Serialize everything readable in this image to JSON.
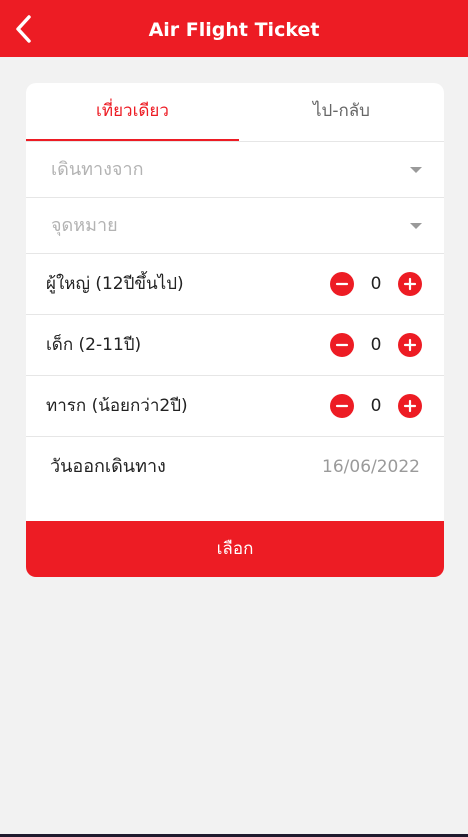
{
  "header": {
    "title": "Air Flight Ticket",
    "back_icon": "chevron-left-icon"
  },
  "colors": {
    "brand": "#ed1c24",
    "background": "#f2f2f2"
  },
  "tabs": [
    {
      "label": "เที่ยวเดียว",
      "active": true
    },
    {
      "label": "ไป-กลับ",
      "active": false
    }
  ],
  "origin": {
    "placeholder": "เดินทางจาก"
  },
  "destination": {
    "placeholder": "จุดหมาย"
  },
  "passengers": [
    {
      "label": "ผู้ใหญ่ (12ปีขึ้นไป)",
      "count": "0"
    },
    {
      "label": "เด็ก (2-11ปี)",
      "count": "0"
    },
    {
      "label": "ทารก (น้อยกว่า2ปี)",
      "count": "0"
    }
  ],
  "departure": {
    "label": "วันออกเดินทาง",
    "value": "16/06/2022"
  },
  "submit": {
    "label": "เลือก"
  }
}
